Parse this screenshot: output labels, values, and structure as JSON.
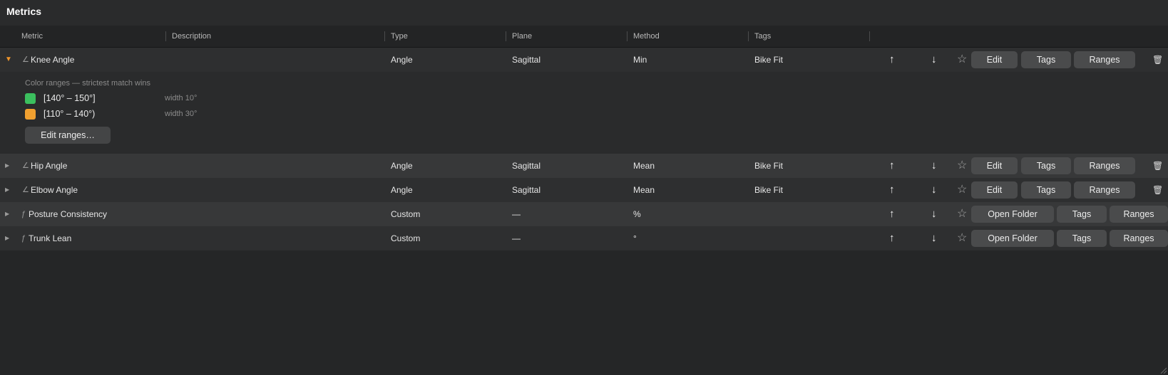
{
  "window": {
    "title": "Metrics"
  },
  "columns": {
    "metric": "Metric",
    "description": "Description",
    "type": "Type",
    "plane": "Plane",
    "method": "Method",
    "tags": "Tags"
  },
  "rows": [
    {
      "marker": "∠",
      "name": "Knee Angle",
      "description": "",
      "type": "Angle",
      "plane": "Sagittal",
      "method": "Min",
      "tags": "Bike Fit",
      "expanded": true,
      "actions": {
        "edit": "Edit",
        "tags": "Tags",
        "ranges": "Ranges"
      }
    },
    {
      "marker": "∠",
      "name": "Hip Angle",
      "description": "",
      "type": "Angle",
      "plane": "Sagittal",
      "method": "Mean",
      "tags": "Bike Fit",
      "expanded": false,
      "actions": {
        "edit": "Edit",
        "tags": "Tags",
        "ranges": "Ranges"
      }
    },
    {
      "marker": "∠",
      "name": "Elbow Angle",
      "description": "",
      "type": "Angle",
      "plane": "Sagittal",
      "method": "Mean",
      "tags": "Bike Fit",
      "expanded": false,
      "actions": {
        "edit": "Edit",
        "tags": "Tags",
        "ranges": "Ranges"
      }
    },
    {
      "marker": "ƒ",
      "name": "Posture Consistency",
      "description": "",
      "type": "Custom",
      "plane": "—",
      "method": "%",
      "tags": "",
      "expanded": false,
      "actions": {
        "open": "Open Folder",
        "tags": "Tags",
        "ranges": "Ranges"
      }
    },
    {
      "marker": "ƒ",
      "name": "Trunk Lean",
      "description": "",
      "type": "Custom",
      "plane": "—",
      "method": "°",
      "tags": "",
      "expanded": false,
      "actions": {
        "open": "Open Folder",
        "tags": "Tags",
        "ranges": "Ranges"
      }
    }
  ],
  "expanded_detail": {
    "caption": "Color ranges — strictest match wins",
    "ranges": [
      {
        "label": "[140° – 150°]",
        "width": "width 10°",
        "color": "#3bbf5e"
      },
      {
        "label": "[110° – 140°)",
        "width": "width 30°",
        "color": "#f0a030"
      }
    ],
    "edit_button": "Edit ranges…"
  },
  "icons": {
    "row_expand": "triangle-icon",
    "angle_marker": "angle-icon",
    "custom_marker": "function-icon",
    "move_up": "arrow-up-icon",
    "move_down": "arrow-down-icon",
    "favorite": "star-icon",
    "delete": "trash-icon"
  },
  "colors": {
    "background": "#252627",
    "accent_open": "#f0952a"
  }
}
